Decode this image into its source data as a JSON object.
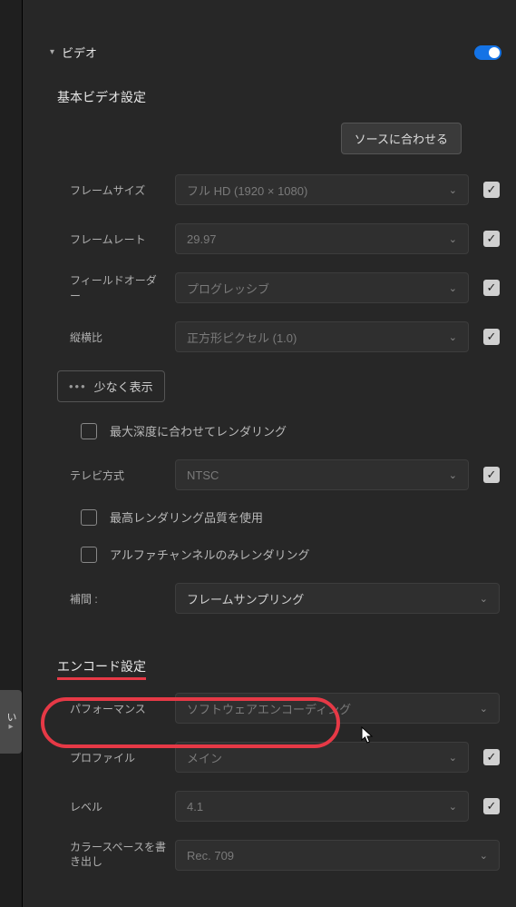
{
  "sidebar_tab": {
    "label": "い"
  },
  "video": {
    "section_label": "ビデオ",
    "toggle_on": true
  },
  "basic_video": {
    "heading": "基本ビデオ設定",
    "match_source_btn": "ソースに合わせる",
    "fields": {
      "frame_size": {
        "label": "フレームサイズ",
        "value": "フル HD (1920 × 1080)"
      },
      "frame_rate": {
        "label": "フレームレート",
        "value": "29.97"
      },
      "field_order": {
        "label": "フィールドオーダー",
        "value": "プログレッシブ"
      },
      "aspect": {
        "label": "縦横比",
        "value": "正方形ピクセル (1.0)"
      }
    },
    "less_label": "少なく表示",
    "max_depth_label": "最大深度に合わせてレンダリング",
    "tv_standard": {
      "label": "テレビ方式",
      "value": "NTSC"
    },
    "max_quality_label": "最高レンダリング品質を使用",
    "alpha_only_label": "アルファチャンネルのみレンダリング",
    "interp": {
      "label": "補間 :",
      "value": "フレームサンプリング"
    }
  },
  "encode": {
    "heading": "エンコード設定",
    "performance": {
      "label": "パフォーマンス",
      "value": "ソフトウェアエンコーディング"
    },
    "profile": {
      "label": "プロファイル",
      "value": "メイン"
    },
    "level": {
      "label": "レベル",
      "value": "4.1"
    },
    "color_space": {
      "label": "カラースペースを書き出し",
      "value": "Rec. 709"
    }
  }
}
